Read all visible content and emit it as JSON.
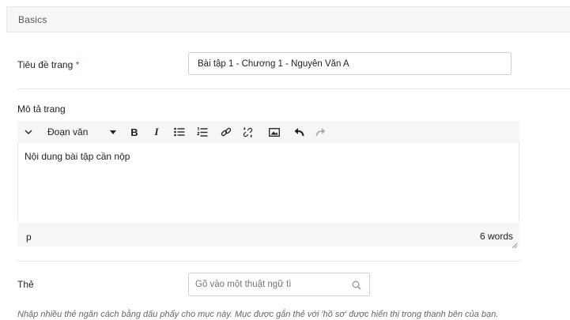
{
  "section": {
    "title": "Basics"
  },
  "fields": {
    "page_title": {
      "label": "Tiêu đề trang",
      "required_mark": "*",
      "value": "Bài tập 1 - Chương 1 - Nguyễn Văn A"
    },
    "description": {
      "label": "Mô tả trang"
    },
    "tags": {
      "label": "Thẻ",
      "placeholder": "Gõ vào một thuật ngữ tì"
    }
  },
  "editor": {
    "toolbar": {
      "collapse_icon": "chevron-down-icon",
      "format_label": "Đoạn văn",
      "buttons": [
        "bold-icon",
        "italic-icon",
        "bullet-list-icon",
        "numbered-list-icon",
        "link-icon",
        "unlink-icon",
        "image-icon",
        "undo-icon",
        "redo-icon"
      ],
      "bold_glyph": "B",
      "italic_glyph": "I"
    },
    "content": "Nội dung bài tập cần nộp",
    "status": {
      "path": "p",
      "word_count": "6 words"
    }
  },
  "help_text": "Nhập nhiều thẻ ngăn cách bằng dấu phẩy cho mục này. Mục được gắn thẻ với 'hồ sơ' được hiển thị trong thanh bên của bạn."
}
